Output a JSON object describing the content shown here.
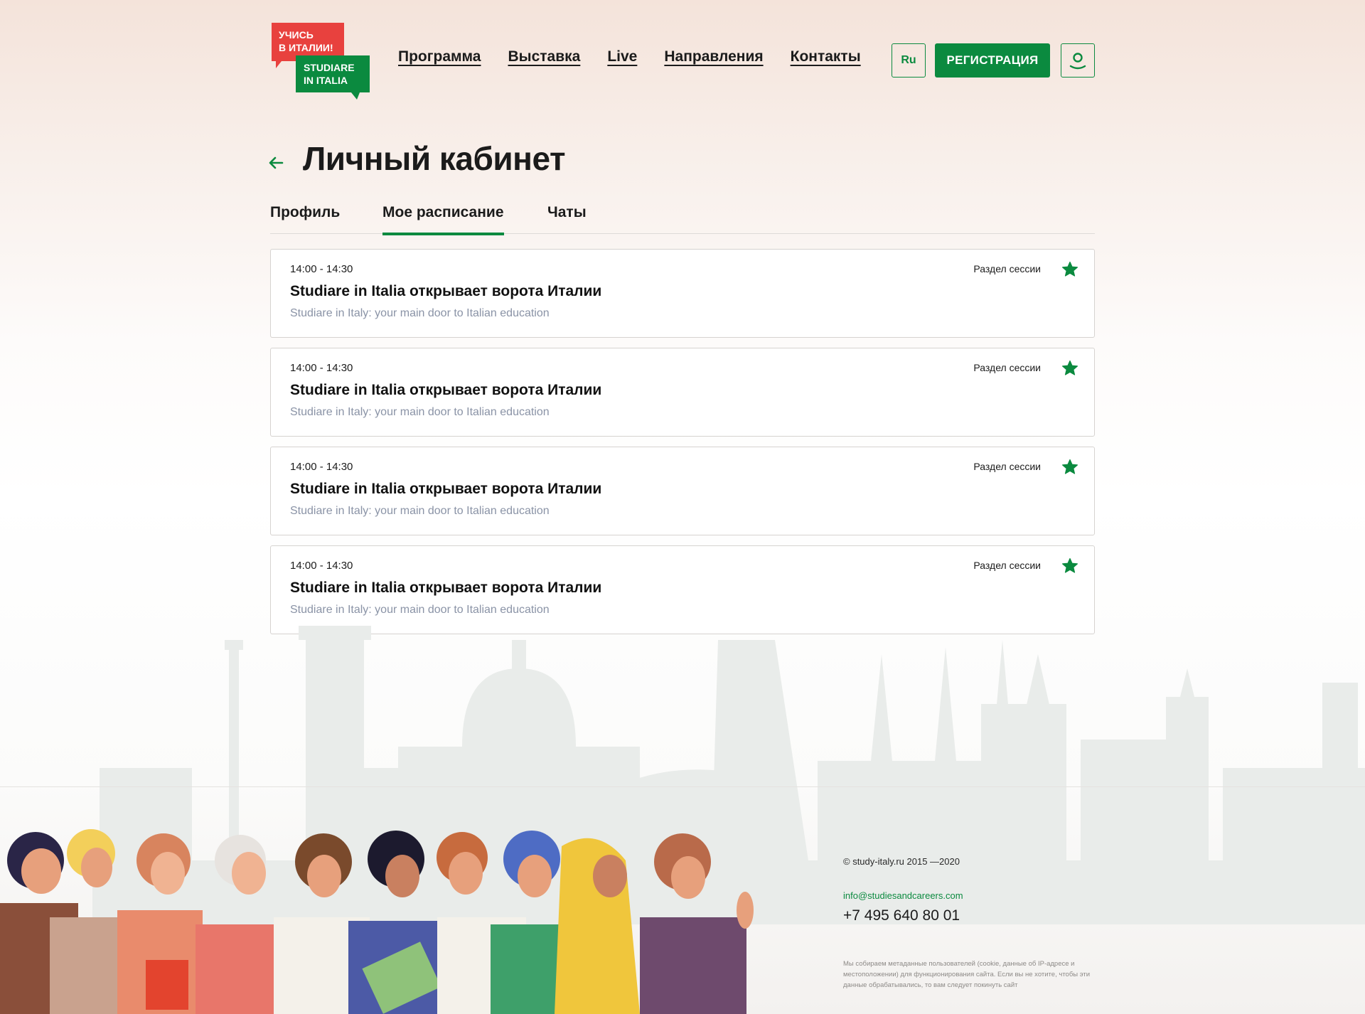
{
  "logo": {
    "line1": "УЧИСЬ",
    "line2": "В ИТАЛИИ!",
    "line3": "STUDIARE",
    "line4": "IN ITALIA"
  },
  "nav": {
    "items": [
      "Программа",
      "Выставка",
      "Live",
      "Направления",
      "Контакты"
    ]
  },
  "header": {
    "lang_label": "Ru",
    "register_label": "РЕГИСТРАЦИЯ"
  },
  "page": {
    "title": "Личный кабинет"
  },
  "tabs": [
    {
      "label": "Профиль",
      "active": false
    },
    {
      "label": "Мое расписание",
      "active": true
    },
    {
      "label": "Чаты",
      "active": false
    }
  ],
  "sessions": [
    {
      "time": "14:00 - 14:30",
      "title": "Studiare in Italia открывает ворота Италии",
      "subtitle": "Studiare in Italy: your main door to Italian education",
      "section": "Раздел сессии",
      "favorite": true
    },
    {
      "time": "14:00 - 14:30",
      "title": "Studiare in Italia открывает ворота Италии",
      "subtitle": "Studiare in Italy: your main door to Italian education",
      "section": "Раздел сессии",
      "favorite": true
    },
    {
      "time": "14:00 - 14:30",
      "title": "Studiare in Italia открывает ворота Италии",
      "subtitle": "Studiare in Italy: your main door to Italian education",
      "section": "Раздел сессии",
      "favorite": true
    },
    {
      "time": "14:00 - 14:30",
      "title": "Studiare in Italia открывает ворота Италии",
      "subtitle": "Studiare in Italy: your main door to Italian education",
      "section": "Раздел сессии",
      "favorite": true
    }
  ],
  "footer": {
    "copyright": "© study-italy.ru 2015 —2020",
    "email": "info@studiesandcareers.com",
    "phone": "+7 495 640 80 01",
    "cookie_notice": "Мы собираем метаданные пользователей (cookie, данные об IP-адресе и местоположении) для функционирования сайта. Если вы не хотите, чтобы эти данные обрабатывались, то вам следует покинуть сайт"
  },
  "colors": {
    "brand_green": "#0b8a3f",
    "brand_red": "#e8413e",
    "muted_text": "#8a93a6"
  },
  "icons": [
    "back-arrow-icon",
    "user-icon",
    "star-icon"
  ]
}
